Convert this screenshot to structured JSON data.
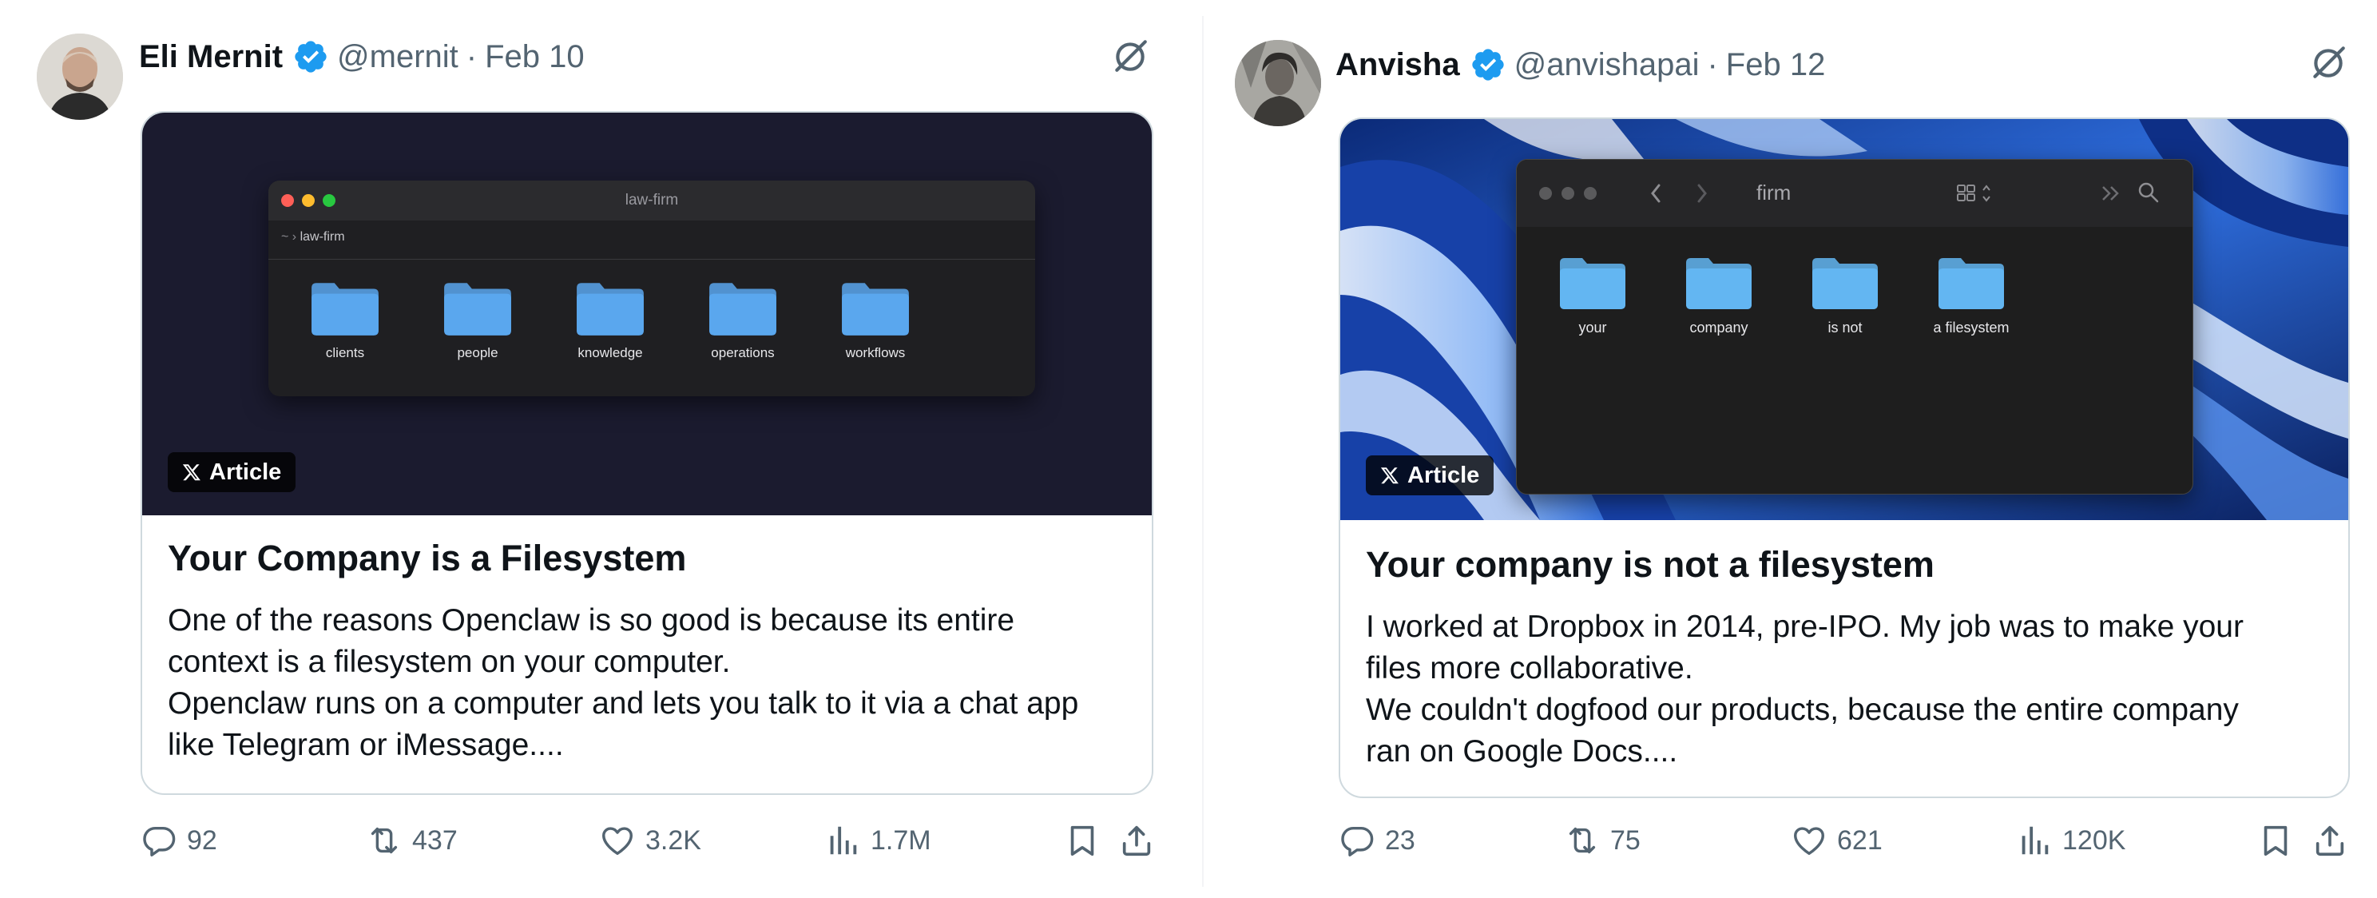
{
  "tweets": [
    {
      "name": "Eli Mernit",
      "handle": "@mernit",
      "separator": "·",
      "date": "Feb 10",
      "card": {
        "badge": "Article",
        "window_title": "law-firm",
        "path_root": "~",
        "path_arrow": "›",
        "path_folder": "law-firm",
        "folders": [
          "clients",
          "people",
          "knowledge",
          "operations",
          "workflows"
        ],
        "title": "Your Company is a Filesystem",
        "body": [
          "One of the reasons Openclaw is so good is because its entire",
          "context is a filesystem on your computer.",
          "Openclaw runs on a computer and lets you talk to it via a chat app",
          "like Telegram or iMessage...."
        ]
      },
      "actions": {
        "replies": "92",
        "reposts": "437",
        "likes": "3.2K",
        "views": "1.7M"
      }
    },
    {
      "name": "Anvisha",
      "handle": "@anvishapai",
      "separator": "·",
      "date": "Feb 12",
      "card": {
        "badge": "Article",
        "window_title": "firm",
        "folders": [
          "your",
          "company",
          "is not",
          "a filesystem"
        ],
        "title": "Your company is not a filesystem",
        "body": [
          "I worked at Dropbox in 2014, pre-IPO. My job was to make your",
          "files more collaborative.",
          "We couldn't dogfood our products, because the entire company",
          "ran on Google Docs...."
        ]
      },
      "actions": {
        "replies": "23",
        "reposts": "75",
        "likes": "621",
        "views": "120K"
      }
    }
  ],
  "colors": {
    "verified_badge": "#1d9bf0",
    "secondary_text": "#536471",
    "card_border": "#cfd9de",
    "folder_blue": "#5aa7ee"
  },
  "icons": {
    "verified": "verified-badge-icon",
    "grok": "grok-icon",
    "reply": "reply-icon",
    "repost": "repost-icon",
    "like": "heart-icon",
    "views": "views-icon",
    "bookmark": "bookmark-icon",
    "share": "share-icon",
    "x_logo": "x-logo-icon"
  }
}
